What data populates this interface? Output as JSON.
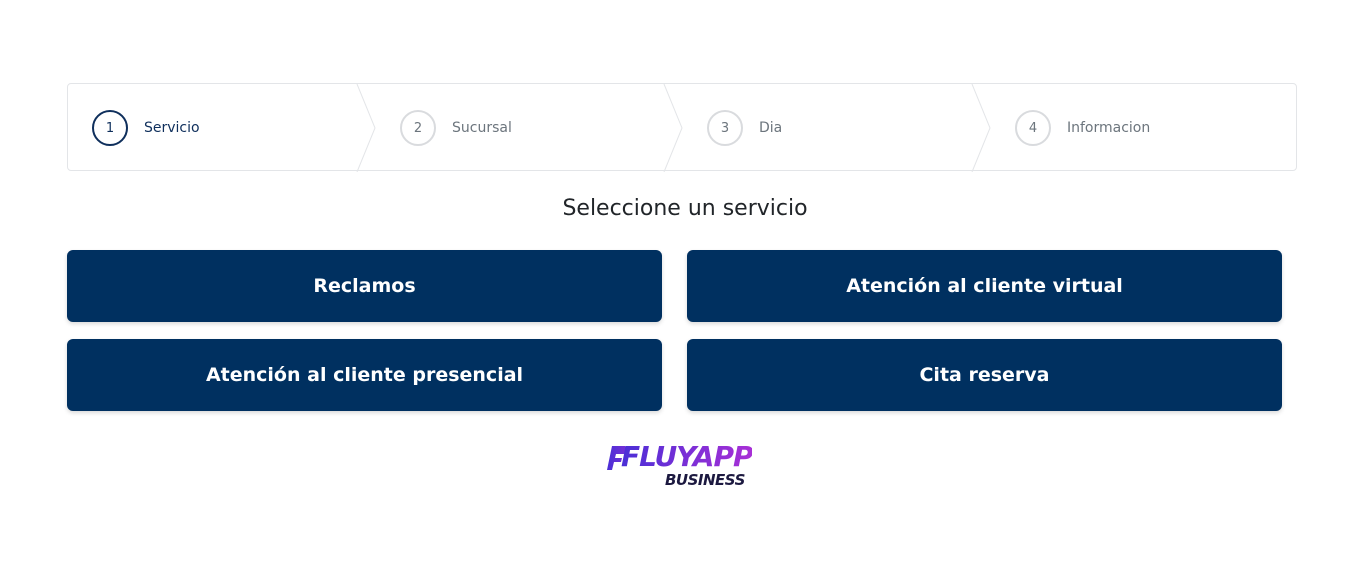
{
  "stepper": {
    "steps": [
      {
        "number": "1",
        "label": "Servicio",
        "active": true
      },
      {
        "number": "2",
        "label": "Sucursal",
        "active": false
      },
      {
        "number": "3",
        "label": "Dia",
        "active": false
      },
      {
        "number": "4",
        "label": "Informacion",
        "active": false
      }
    ]
  },
  "main": {
    "heading": "Seleccione un servicio",
    "services": [
      {
        "label": "Reclamos"
      },
      {
        "label": "Atención al cliente virtual"
      },
      {
        "label": "Atención al cliente presencial"
      },
      {
        "label": "Cita reserva"
      }
    ]
  },
  "footer": {
    "logo_text": "FLUYAPP",
    "logo_subtext": "BUSINESS"
  },
  "colors": {
    "primary": "#003060",
    "active_step": "#0f2f5c",
    "inactive_step": "#6c757d",
    "logo_gradient_start": "#4a2fd6",
    "logo_gradient_end": "#a82fd6"
  }
}
